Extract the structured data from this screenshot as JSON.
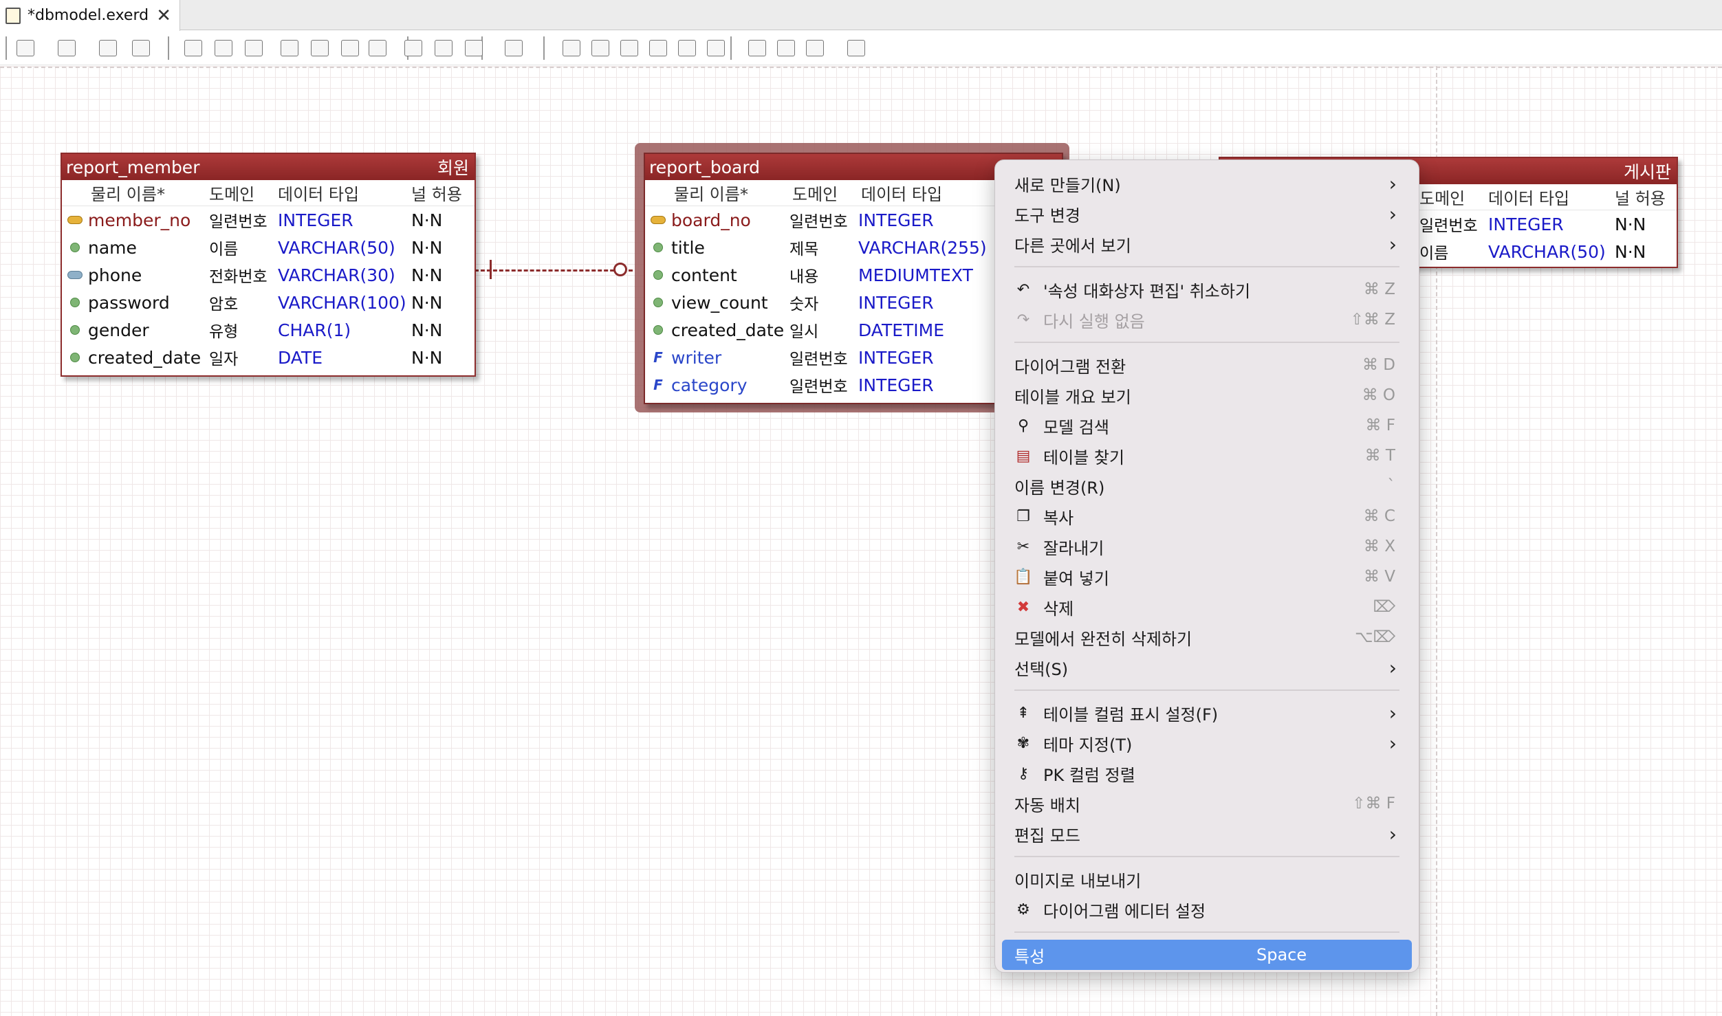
{
  "tab": {
    "title": "*dbmodel.exerd",
    "close": "✕"
  },
  "toolbar": {
    "icons": [
      "physical-model-icon",
      "entity-toggle-icon",
      "table-view-icon",
      "layout-icon",
      "pointer-icon",
      "hand-icon",
      "zoom-icon",
      "table-icon",
      "relation-icon",
      "relation2-icon",
      "note-icon",
      "export-icon",
      "print-icon",
      "image-icon",
      "theme-icon",
      "align-left-icon",
      "align-center-icon",
      "align-right-icon",
      "align-top-icon",
      "align-middle-icon",
      "align-bottom-icon",
      "page-icon",
      "validate-icon",
      "generate-icon",
      "forward-icon"
    ]
  },
  "entities": {
    "member": {
      "name": "report_member",
      "logical": "회원",
      "headers": [
        "물리 이름*",
        "도메인",
        "데이터 타입",
        "널 허용"
      ],
      "rows": [
        {
          "name": "member_no",
          "domain": "일련번호",
          "type": "INTEGER",
          "nullable": "N·N",
          "kind": "pk"
        },
        {
          "name": "name",
          "domain": "이름",
          "type": "VARCHAR(50)",
          "nullable": "N·N",
          "kind": "col"
        },
        {
          "name": "phone",
          "domain": "전화번호",
          "type": "VARCHAR(30)",
          "nullable": "N·N",
          "kind": "ak"
        },
        {
          "name": "password",
          "domain": "암호",
          "type": "VARCHAR(100)",
          "nullable": "N·N",
          "kind": "col"
        },
        {
          "name": "gender",
          "domain": "유형",
          "type": "CHAR(1)",
          "nullable": "N·N",
          "kind": "col"
        },
        {
          "name": "created_date",
          "domain": "일자",
          "type": "DATE",
          "nullable": "N·N",
          "kind": "col"
        }
      ]
    },
    "board": {
      "name": "report_board",
      "headers": [
        "물리 이름*",
        "도메인",
        "데이터 타입"
      ],
      "rows": [
        {
          "name": "board_no",
          "domain": "일련번호",
          "type": "INTEGER",
          "kind": "pk"
        },
        {
          "name": "title",
          "domain": "제목",
          "type": "VARCHAR(255)",
          "kind": "col"
        },
        {
          "name": "content",
          "domain": "내용",
          "type": "MEDIUMTEXT",
          "kind": "col"
        },
        {
          "name": "view_count",
          "domain": "숫자",
          "type": "INTEGER",
          "kind": "col"
        },
        {
          "name": "created_date",
          "domain": "일시",
          "type": "DATETIME",
          "kind": "col"
        },
        {
          "name": "writer",
          "domain": "일련번호",
          "type": "INTEGER",
          "kind": "fk"
        },
        {
          "name": "category",
          "domain": "일련번호",
          "type": "INTEGER",
          "kind": "fk"
        }
      ]
    },
    "category": {
      "logical": "게시판",
      "headers": [
        "도메인",
        "데이터 타입",
        "널 허용"
      ],
      "rows": [
        {
          "domain": "일련번호",
          "type": "INTEGER",
          "nullable": "N·N"
        },
        {
          "domain": "이름",
          "type": "VARCHAR(50)",
          "nullable": "N·N"
        }
      ]
    }
  },
  "menu": {
    "items": [
      {
        "label": "새로 만들기(N)",
        "submenu": true
      },
      {
        "label": "도구 변경",
        "submenu": true
      },
      {
        "label": "다른 곳에서 보기",
        "submenu": true
      },
      {
        "sep": true
      },
      {
        "label": "'속성 대화상자 편집' 취소하기",
        "shortcut": "⌘ Z",
        "icon": "undo-icon",
        "glyph": "↶"
      },
      {
        "label": "다시 실행 없음",
        "shortcut": "⇧⌘ Z",
        "icon": "redo-icon",
        "glyph": "↷",
        "disabled": true
      },
      {
        "sep": true
      },
      {
        "label": "다이어그램 전환",
        "shortcut": "⌘ D"
      },
      {
        "label": "테이블 개요 보기",
        "shortcut": "⌘ O"
      },
      {
        "label": "모델 검색",
        "shortcut": "⌘ F",
        "icon": "search-icon",
        "glyph": "⚲"
      },
      {
        "label": "테이블 찾기",
        "shortcut": "⌘ T",
        "icon": "table-icon",
        "glyph": "▤"
      },
      {
        "label": "이름 변경(R)",
        "shortcut": "`"
      },
      {
        "label": "복사",
        "shortcut": "⌘ C",
        "icon": "copy-icon",
        "glyph": "❐"
      },
      {
        "label": "잘라내기",
        "shortcut": "⌘ X",
        "icon": "cut-icon",
        "glyph": "✂"
      },
      {
        "label": "붙여 넣기",
        "shortcut": "⌘ V",
        "icon": "paste-icon",
        "glyph": "📋"
      },
      {
        "label": "삭제",
        "shortcut": "⌦",
        "icon": "delete-icon",
        "glyph": "✖"
      },
      {
        "label": "모델에서 완전히 삭제하기",
        "shortcut": "⌥⌦"
      },
      {
        "label": "선택(S)",
        "submenu": true
      },
      {
        "sep": true
      },
      {
        "label": "테이블 컬럼 표시 설정(F)",
        "submenu": true,
        "icon": "column-display-icon",
        "glyph": "⇞"
      },
      {
        "label": "테마 지정(T)",
        "submenu": true,
        "icon": "theme-icon",
        "glyph": "✾"
      },
      {
        "label": "PK 컬럼 정렬",
        "icon": "pk-sort-icon",
        "glyph": "⚷"
      },
      {
        "label": "자동 배치",
        "shortcut": "⇧⌘ F"
      },
      {
        "label": "편집 모드",
        "submenu": true
      },
      {
        "sep": true
      },
      {
        "label": "이미지로 내보내기"
      },
      {
        "label": "다이어그램 에디터 설정",
        "icon": "settings-icon",
        "glyph": "⚙"
      },
      {
        "sep": true
      },
      {
        "label": "특성",
        "shortcut": "Space",
        "highlighted": true
      }
    ]
  },
  "colors": {
    "entity_header": "#9b2f2f",
    "datatype": "#1a1ac8",
    "pk": "#8a1b1b",
    "fk": "#2a46c9",
    "menu_highlight": "#5d95ec"
  }
}
